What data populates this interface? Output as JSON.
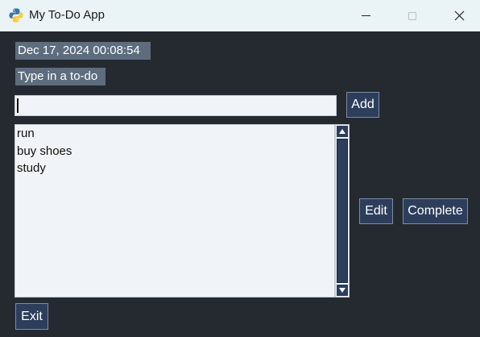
{
  "window": {
    "title": "My To-Do App",
    "icon": "python-icon",
    "controls": [
      "minimize",
      "maximize",
      "close"
    ]
  },
  "clock": {
    "text": "Dec 17, 2024 00:08:54"
  },
  "prompt": {
    "text": "Type in a to-do"
  },
  "todo_input": {
    "value": "",
    "placeholder": ""
  },
  "buttons": {
    "add": "Add",
    "edit": "Edit",
    "complete": "Complete",
    "exit": "Exit"
  },
  "todos": [
    "run",
    "buy shoes",
    "study"
  ],
  "colors": {
    "background": "#252a30",
    "label_bg": "#5d6d7e",
    "button_bg": "#2d3e5c",
    "field_bg": "#f0f4f8",
    "titlebar_bg": "#eaf3f6"
  }
}
